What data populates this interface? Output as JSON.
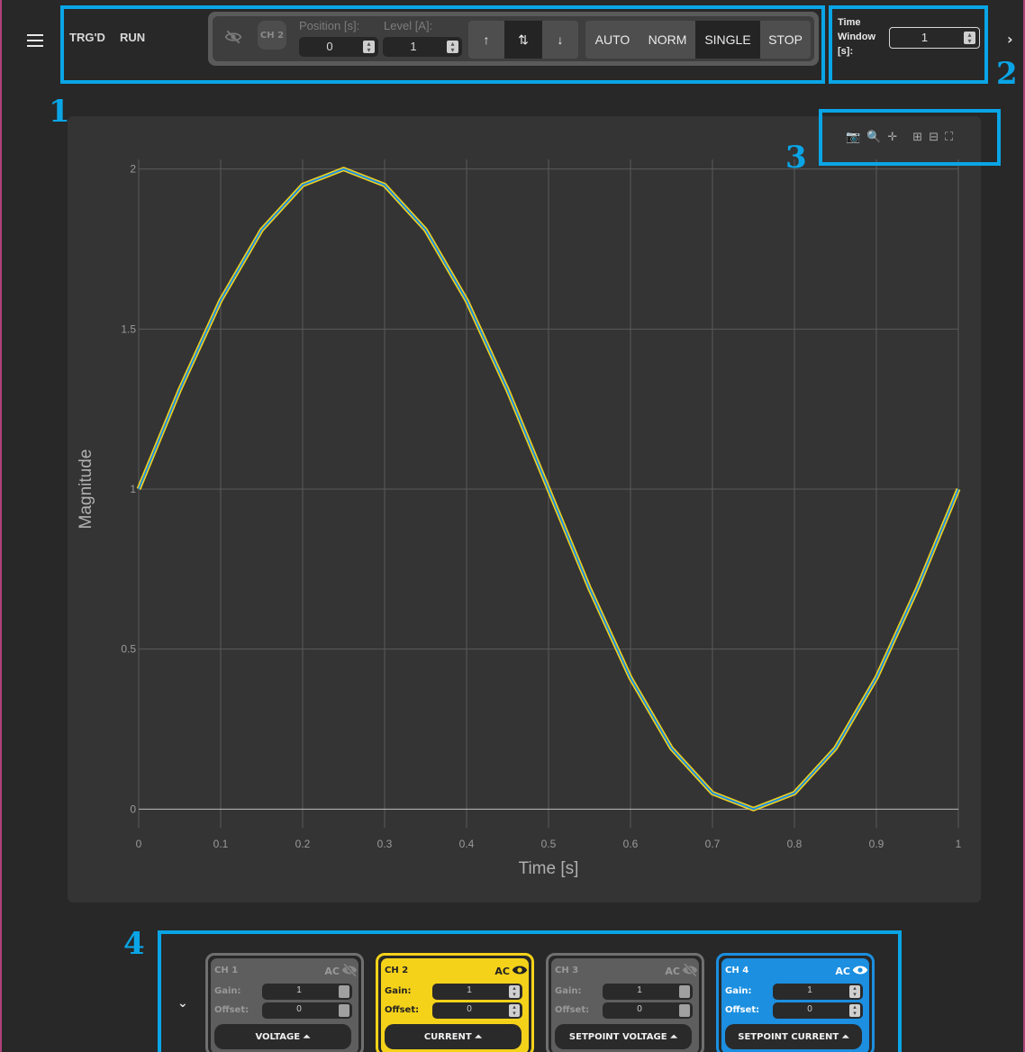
{
  "status": {
    "triggered": "TRG'D",
    "run": "RUN"
  },
  "trigger": {
    "channel": "CH 2",
    "position_label": "Position [s]:",
    "position_value": "0",
    "level_label": "Level [A]:",
    "level_value": "1",
    "edge_up": "↑",
    "edge_both": "⇅",
    "edge_down": "↓",
    "modes": [
      "AUTO",
      "NORM",
      "SINGLE",
      "STOP"
    ],
    "active_mode": "SINGLE"
  },
  "time_window": {
    "label_line1": "Time",
    "label_line2": "Window",
    "label_line3": "[s]:",
    "value": "1"
  },
  "callouts": [
    "1",
    "2",
    "3",
    "4"
  ],
  "plot": {
    "modebar_icons": [
      "camera-icon",
      "zoom-icon",
      "pan-icon",
      "zoom-in-icon",
      "zoom-out-icon",
      "autoscale-icon"
    ]
  },
  "chart_data": {
    "type": "line",
    "title": "",
    "xlabel": "Time [s]",
    "ylabel": "Magnitude",
    "xlim": [
      0,
      1
    ],
    "ylim": [
      -0.03,
      2.03
    ],
    "xticks": [
      "0",
      "0.1",
      "0.2",
      "0.3",
      "0.4",
      "0.5",
      "0.6",
      "0.7",
      "0.8",
      "0.9",
      "1"
    ],
    "yticks": [
      "0",
      "0.5",
      "1",
      "1.5",
      "2"
    ],
    "grid": true,
    "series": [
      {
        "color": "#f5d21a",
        "x": [
          0,
          0.05,
          0.1,
          0.15,
          0.2,
          0.25,
          0.3,
          0.35,
          0.4,
          0.45,
          0.5,
          0.55,
          0.6,
          0.65,
          0.7,
          0.75,
          0.8,
          0.85,
          0.9,
          0.95,
          1
        ],
        "values": [
          1,
          1.31,
          1.59,
          1.81,
          1.95,
          2,
          1.95,
          1.81,
          1.59,
          1.31,
          1,
          0.69,
          0.41,
          0.19,
          0.05,
          0,
          0.05,
          0.19,
          0.41,
          0.69,
          1
        ]
      },
      {
        "color": "#1c8fe0",
        "x": [
          0,
          0.05,
          0.1,
          0.15,
          0.2,
          0.25,
          0.3,
          0.35,
          0.4,
          0.45,
          0.5,
          0.55,
          0.6,
          0.65,
          0.7,
          0.75,
          0.8,
          0.85,
          0.9,
          0.95,
          1
        ],
        "values": [
          1,
          1.31,
          1.59,
          1.81,
          1.95,
          2,
          1.95,
          1.81,
          1.59,
          1.31,
          1,
          0.69,
          0.41,
          0.19,
          0.05,
          0,
          0.05,
          0.19,
          0.41,
          0.69,
          1
        ]
      }
    ]
  },
  "channels": [
    {
      "name": "CH 1",
      "coupling": "AC",
      "visible": false,
      "gain_label": "Gain:",
      "gain": "1",
      "offset_label": "Offset:",
      "offset": "0",
      "signal": "VOLTAGE ⏶",
      "color": "#5e5e5e"
    },
    {
      "name": "CH 2",
      "coupling": "AC",
      "visible": true,
      "gain_label": "Gain:",
      "gain": "1",
      "offset_label": "Offset:",
      "offset": "0",
      "signal": "CURRENT ⏶",
      "color": "#f5d21a"
    },
    {
      "name": "CH 3",
      "coupling": "AC",
      "visible": false,
      "gain_label": "Gain:",
      "gain": "1",
      "offset_label": "Offset:",
      "offset": "0",
      "signal": "SETPOINT VOLTAGE ⏶",
      "color": "#5e5e5e"
    },
    {
      "name": "CH 4",
      "coupling": "AC",
      "visible": true,
      "gain_label": "Gain:",
      "gain": "1",
      "offset_label": "Offset:",
      "offset": "0",
      "signal": "SETPOINT CURRENT ⏶",
      "color": "#1c8fe0"
    }
  ]
}
